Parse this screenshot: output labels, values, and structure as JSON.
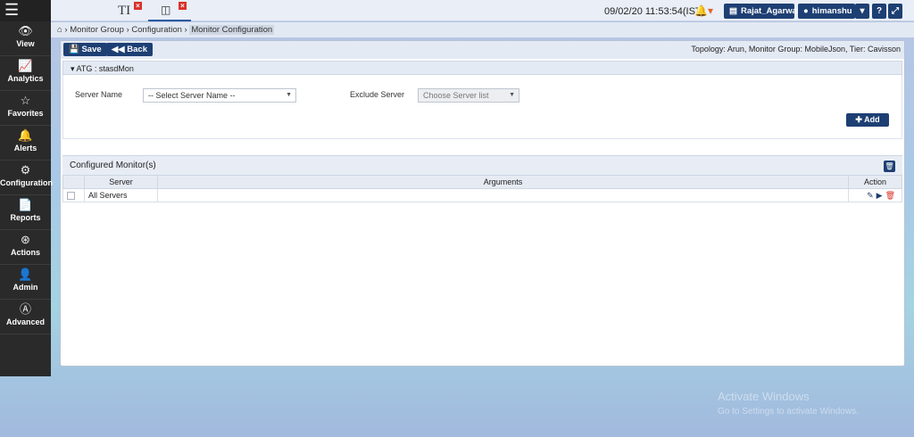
{
  "topbar": {
    "menu_icon": "hamburger-icon",
    "tabs": [
      {
        "icon": "TI",
        "close": "×"
      },
      {
        "icon": "◫",
        "close": "×"
      }
    ],
    "datetime": "09/02/20 11:53:54(IST)",
    "alert_icon": "bell-icon",
    "project_label": "Rajat_Agarwal",
    "user_label": "himanshu",
    "help_icon": "?",
    "fullscreen_icon": "⤢"
  },
  "sidebar": {
    "items": [
      {
        "label": "View",
        "icon": "eye-icon",
        "glyph": "👁"
      },
      {
        "label": "Analytics",
        "icon": "chart-icon",
        "glyph": "📈"
      },
      {
        "label": "Favorites",
        "icon": "star-icon",
        "glyph": "☆"
      },
      {
        "label": "Alerts",
        "icon": "bell-icon",
        "glyph": "🔔"
      },
      {
        "label": "Configuration",
        "icon": "gears-icon",
        "glyph": "⚙"
      },
      {
        "label": "Reports",
        "icon": "document-icon",
        "glyph": "📄"
      },
      {
        "label": "Actions",
        "icon": "actions-icon",
        "glyph": "⊛"
      },
      {
        "label": "Admin",
        "icon": "user-icon",
        "glyph": "👤"
      },
      {
        "label": "Advanced",
        "icon": "advanced-icon",
        "glyph": "Ⓐ"
      }
    ]
  },
  "breadcrumb": {
    "home_icon": "⌂",
    "items": [
      "Monitor Group",
      "Configuration",
      "Monitor Configuration"
    ]
  },
  "toolbar": {
    "save_label": "Save",
    "back_label": "Back",
    "topology": "Topology: Arun, Monitor Group: MobileJson, Tier: Cavisson"
  },
  "accordion": {
    "title": "ATG : stasdMon",
    "server_name_label": "Server Name",
    "server_name_value": "-- Select Server Name --",
    "exclude_server_label": "Exclude Server",
    "exclude_server_value": "Choose Server list",
    "add_label": "Add"
  },
  "configured": {
    "title": "Configured Monitor(s)",
    "columns": [
      "Server",
      "Arguments",
      "Action"
    ],
    "rows": [
      {
        "server": "All Servers",
        "arguments": ""
      }
    ]
  },
  "watermark": {
    "line1": "Activate Windows",
    "line2": "Go to Settings to activate Windows."
  }
}
